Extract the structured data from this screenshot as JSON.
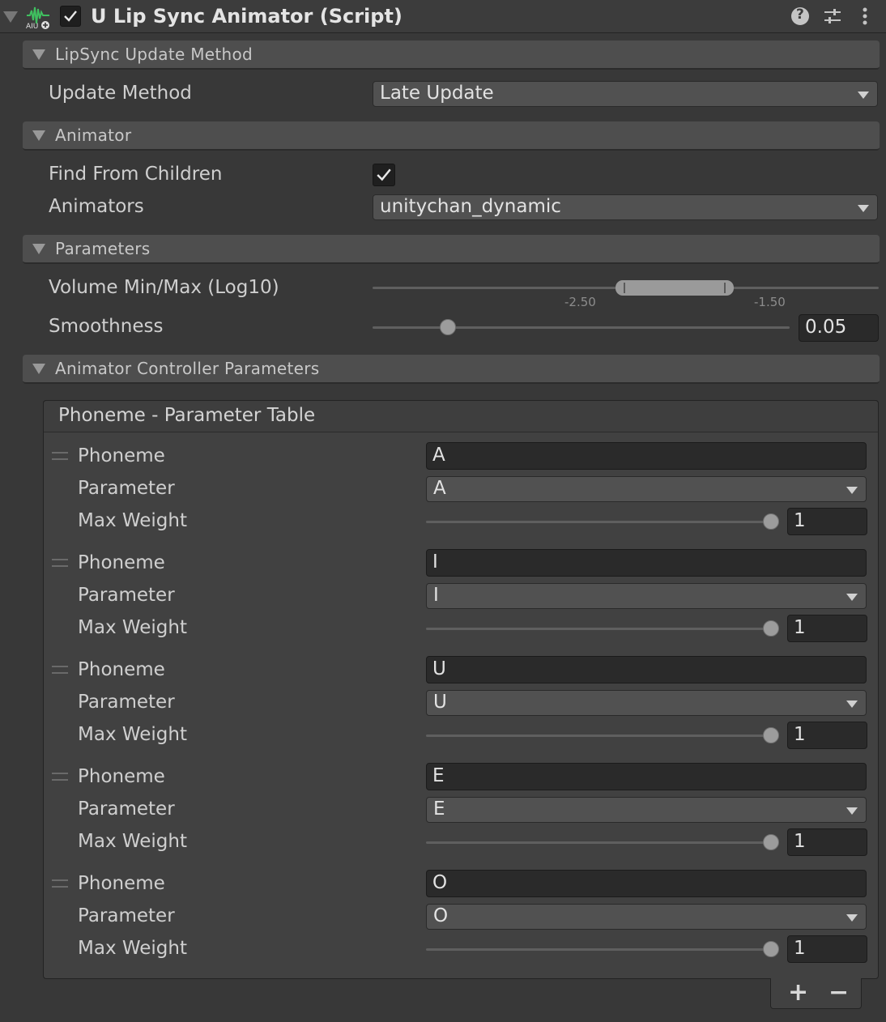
{
  "component": {
    "title": "U Lip Sync Animator (Script)",
    "enabled": true,
    "icon_name": "ulipsync-animator-icon",
    "header_icons": [
      "help-icon",
      "presets-icon",
      "kebab-menu-icon"
    ]
  },
  "sections": {
    "update_method": {
      "header": "LipSync Update Method",
      "update_method_label": "Update Method",
      "update_method_value": "Late Update"
    },
    "animator": {
      "header": "Animator",
      "find_from_children_label": "Find From Children",
      "find_from_children": true,
      "animators_label": "Animators",
      "animators_value": "unitychan_dynamic"
    },
    "parameters": {
      "header": "Parameters",
      "volume_label": "Volume Min/Max (Log10)",
      "volume_min_tick": "-2.50",
      "volume_max_tick": "-1.50",
      "smoothness_label": "Smoothness",
      "smoothness_value": "0.05"
    },
    "controller": {
      "header": "Animator Controller Parameters",
      "table_title": "Phoneme - Parameter Table",
      "rows": [
        {
          "phoneme_label": "Phoneme",
          "phoneme": "A",
          "parameter_label": "Parameter",
          "parameter": "A",
          "weight_label": "Max Weight",
          "weight": "1"
        },
        {
          "phoneme_label": "Phoneme",
          "phoneme": "I",
          "parameter_label": "Parameter",
          "parameter": "I",
          "weight_label": "Max Weight",
          "weight": "1"
        },
        {
          "phoneme_label": "Phoneme",
          "phoneme": "U",
          "parameter_label": "Parameter",
          "parameter": "U",
          "weight_label": "Max Weight",
          "weight": "1"
        },
        {
          "phoneme_label": "Phoneme",
          "phoneme": "E",
          "parameter_label": "Parameter",
          "parameter": "E",
          "weight_label": "Max Weight",
          "weight": "1"
        },
        {
          "phoneme_label": "Phoneme",
          "phoneme": "O",
          "parameter_label": "Parameter",
          "parameter": "O",
          "weight_label": "Max Weight",
          "weight": "1"
        }
      ],
      "add_label": "+",
      "remove_label": "−"
    }
  },
  "colors": {
    "background": "#383838",
    "section_header": "#4e4e4e",
    "field": "#2a2a2a",
    "dropdown": "#515151",
    "icon_green": "#3fbf5f"
  }
}
